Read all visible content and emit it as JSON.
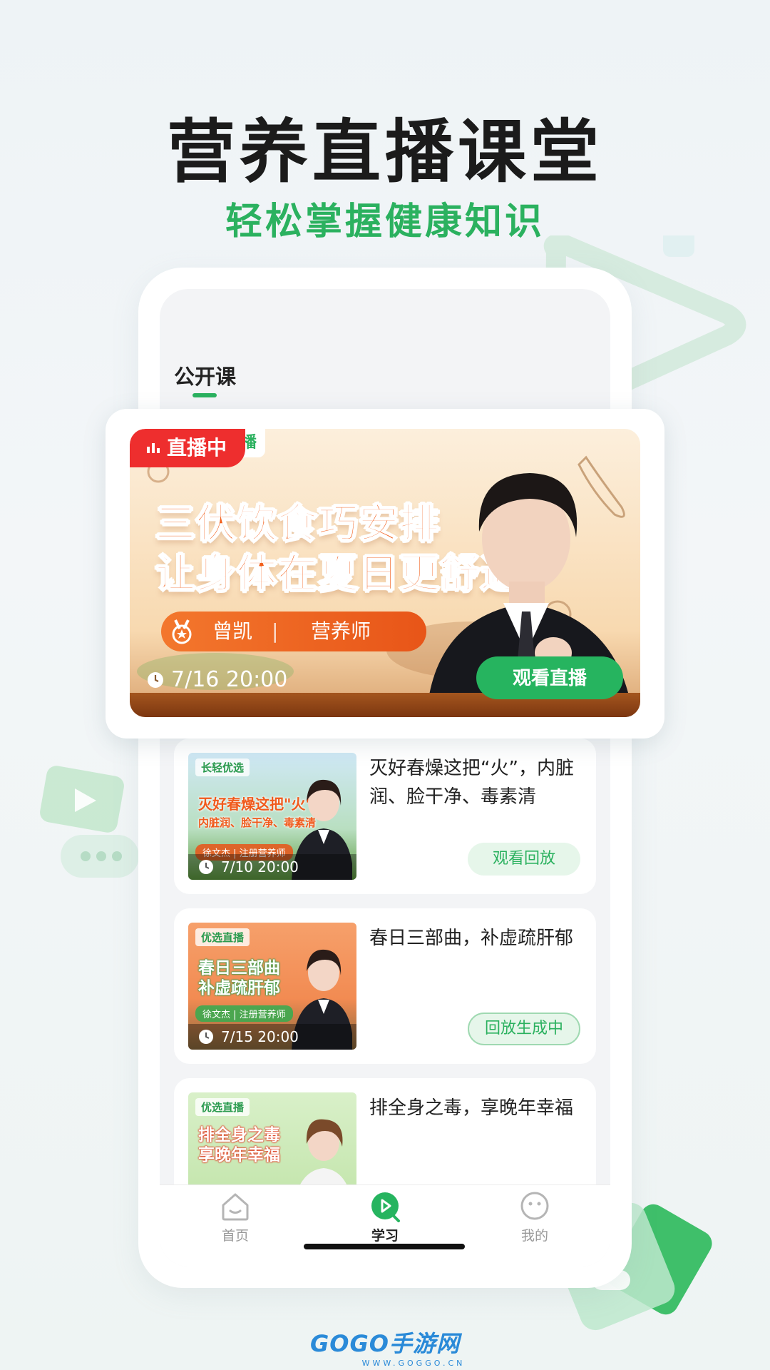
{
  "hero": {
    "title": "营养直播课堂",
    "subtitle": "轻松掌握健康知识"
  },
  "screen": {
    "tab_label": "公开课"
  },
  "featured": {
    "live_badge": "直播中",
    "badge_tail": "播",
    "headline_line1": "三伏饮食巧安排",
    "headline_line2": "让身体在夏日更舒适",
    "host_name": "曾凯",
    "host_separator": "|",
    "host_role": "营养师",
    "time": "7/16 20:00",
    "action": "观看直播"
  },
  "courses": [
    {
      "thumb_tag": "长轻优选",
      "thumb_title_1": "灭好春燥这把\"火\"",
      "thumb_title_2": "内脏润、脸干净、毒素清",
      "thumb_host": "徐文杰 | 注册营养师",
      "thumb_time": "7/10 20:00",
      "title": "灭好春燥这把“火”，内脏润、脸干净、毒素清",
      "action": "观看回放"
    },
    {
      "thumb_tag": "优选直播",
      "thumb_title_1": "春日三部曲",
      "thumb_title_2": "补虚疏肝郁",
      "thumb_host": "徐文杰 | 注册营养师",
      "thumb_time": "7/15 20:00",
      "title": "春日三部曲，补虚疏肝郁",
      "action": "回放生成中"
    },
    {
      "thumb_tag": "优选直播",
      "thumb_title_1": "排全身之毒",
      "thumb_title_2": "享晚年幸福",
      "title": "排全身之毒，享晚年幸福"
    }
  ],
  "tabbar": {
    "home": "首页",
    "study": "学习",
    "mine": "我的"
  },
  "watermark": {
    "brand": "GOGO手游网",
    "url": "WWW.GOGGO.CN"
  },
  "colors": {
    "accent": "#2bb15f",
    "live_red": "#ee2e2e"
  }
}
